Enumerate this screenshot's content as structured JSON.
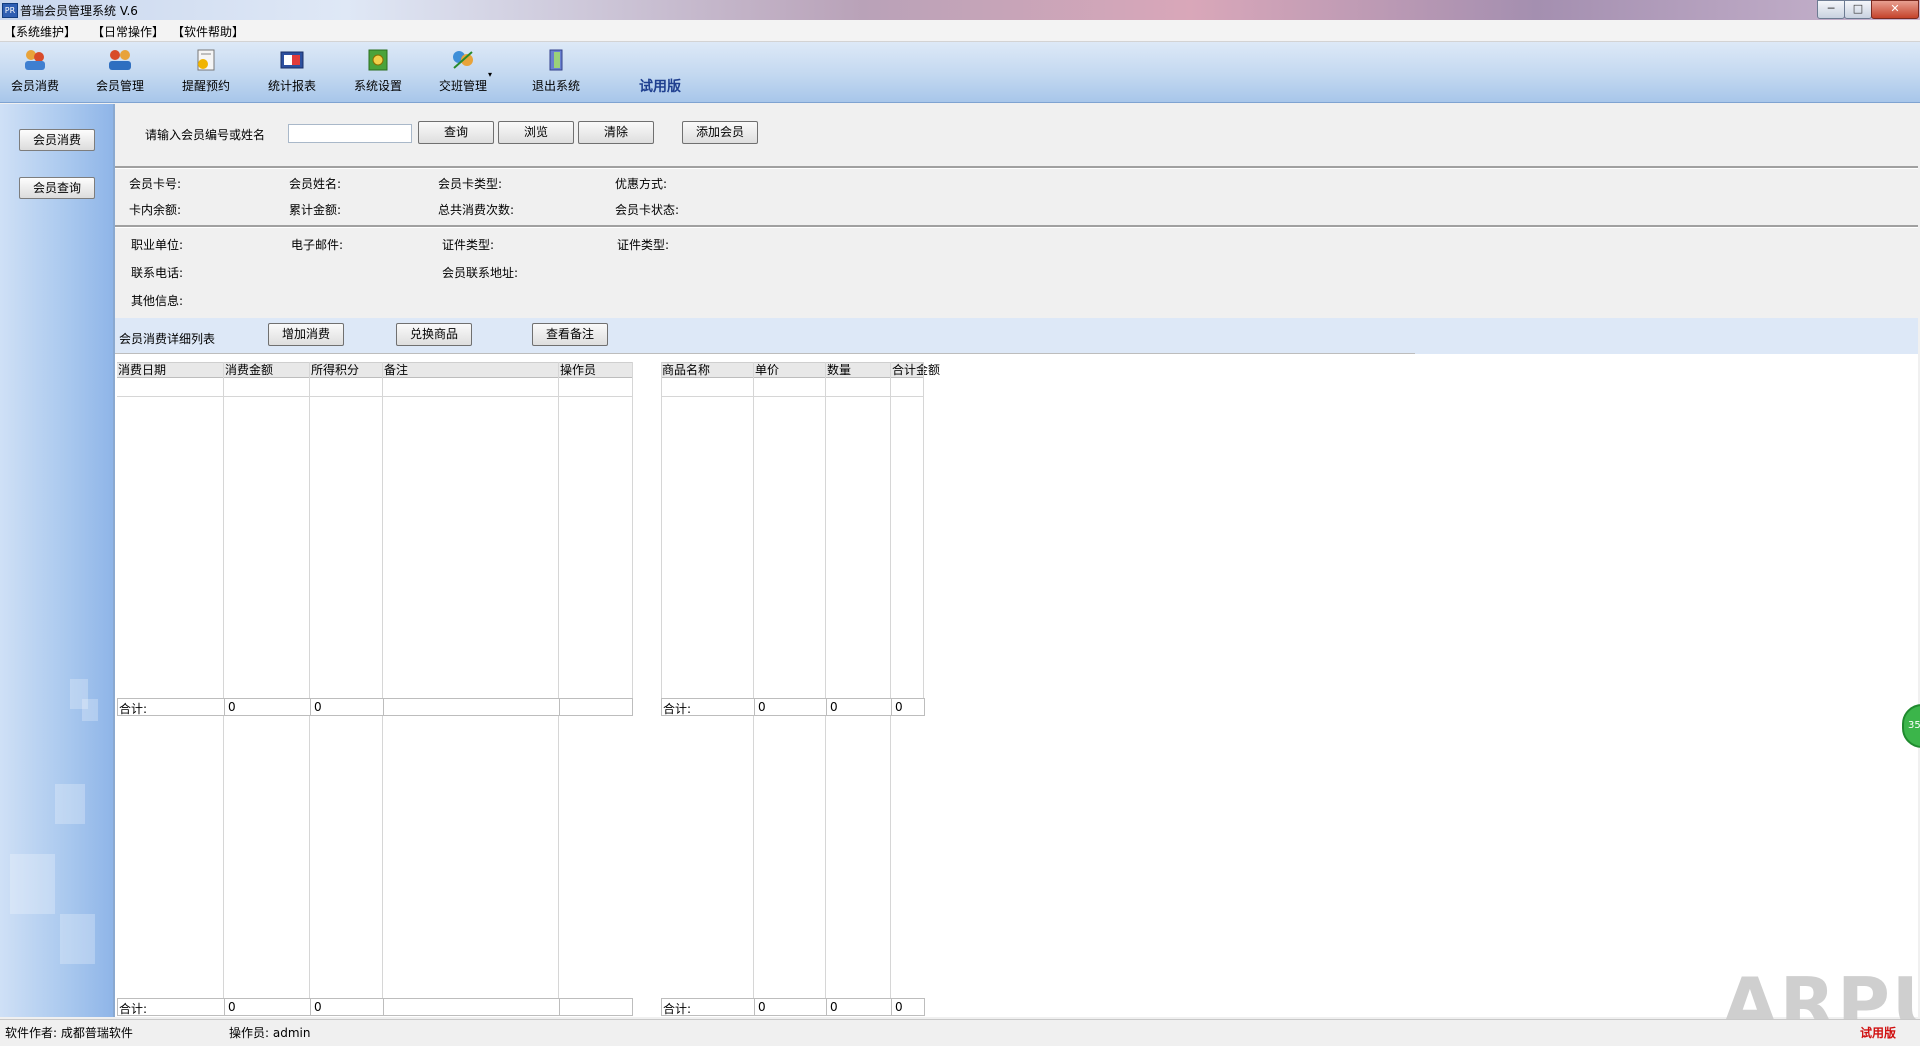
{
  "window": {
    "title": "普瑞会员管理系统 V.6",
    "min": "─",
    "max": "□",
    "close": "✕"
  },
  "menu": [
    "【系统维护】",
    "【日常操作】",
    "【软件帮助】"
  ],
  "toolbar": {
    "items": [
      {
        "label": "会员消费",
        "icon": "member-consume-icon"
      },
      {
        "label": "会员管理",
        "icon": "member-manage-icon"
      },
      {
        "label": "提醒预约",
        "icon": "reminder-icon"
      },
      {
        "label": "统计报表",
        "icon": "report-icon"
      },
      {
        "label": "系统设置",
        "icon": "settings-icon"
      },
      {
        "label": "交班管理",
        "icon": "shift-icon"
      },
      {
        "label": "退出系统",
        "icon": "exit-icon"
      }
    ],
    "trial": "试用版"
  },
  "sidebar": {
    "consume": "会员消费",
    "query": "会员查询"
  },
  "search": {
    "prompt": "请输入会员编号或姓名",
    "value": "",
    "query_btn": "查询",
    "browse_btn": "浏览",
    "clear_btn": "清除",
    "add_btn": "添加会员"
  },
  "info1": {
    "card_no": "会员卡号:",
    "name": "会员姓名:",
    "card_type": "会员卡类型:",
    "discount": "优惠方式:",
    "balance": "卡内余额:",
    "total_amount": "累计金额:",
    "total_count": "总共消费次数:",
    "card_status": "会员卡状态:"
  },
  "info2": {
    "company": "职业单位:",
    "email": "电子邮件:",
    "id_type1": "证件类型:",
    "id_type2": "证件类型:",
    "phone": "联系电话:",
    "address": "会员联系地址:",
    "other": "其他信息:"
  },
  "list": {
    "title": "会员消费详细列表",
    "add_btn": "增加消费",
    "exchange_btn": "兑换商品",
    "notes_btn": "查看备注"
  },
  "left_grid": {
    "headers": [
      "消费日期",
      "消费金额",
      "所得积分",
      "备注",
      "操作员"
    ],
    "sum": [
      "合计:",
      "0",
      "0",
      "",
      ""
    ]
  },
  "right_grid": {
    "headers": [
      "商品名称",
      "单价",
      "数量",
      "合计金额"
    ],
    "sum": [
      "合计:",
      "0",
      "0",
      "0"
    ]
  },
  "left_grid2": {
    "sum": [
      "合计:",
      "0",
      "0",
      "",
      ""
    ]
  },
  "right_grid2": {
    "sum": [
      "合计:",
      "0",
      "0",
      "0"
    ]
  },
  "status": {
    "author": "软件作者: 成都普瑞软件",
    "operator": "操作员: admin",
    "trial": "试用版",
    "watermark": "ARPUN",
    "bubble": "35"
  },
  "colors": {
    "toolbar": "#a8c6ea",
    "sidebar": "#8fb5e8",
    "trial_text": "#d01010",
    "title_accent": "#1f3f8f"
  }
}
